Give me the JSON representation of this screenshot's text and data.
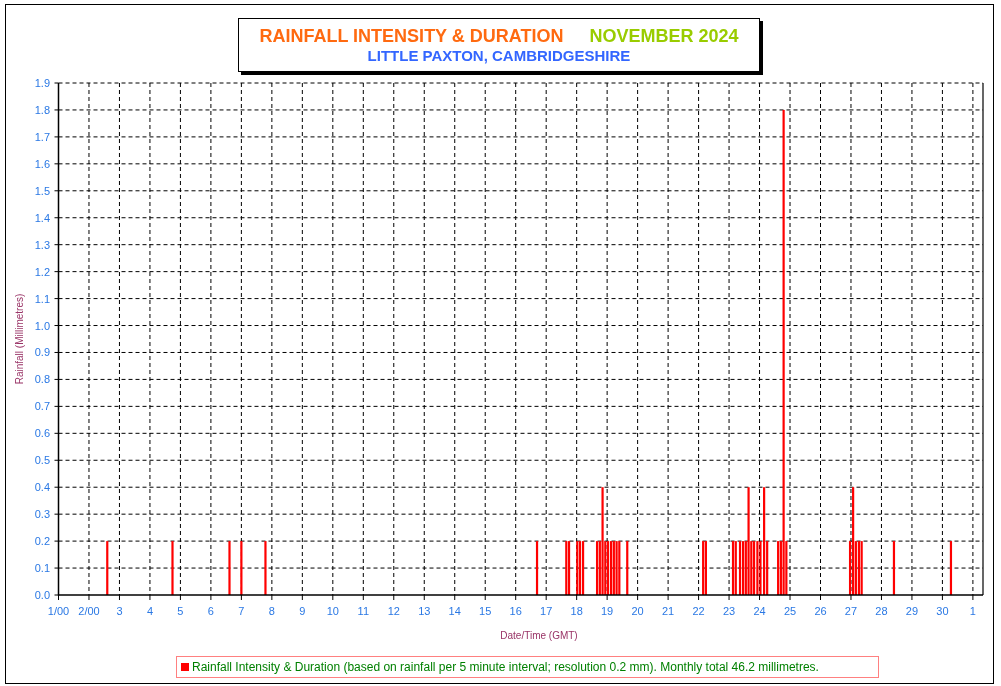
{
  "x_axis": {
    "next_month_label": "1"
  },
  "title": {
    "main": "RAINFALL INTENSITY & DURATION",
    "period": "NOVEMBER 2024",
    "location": "LITTLE PAXTON, CAMBRIDGESHIRE"
  },
  "chart_data": {
    "type": "bar",
    "xlabel": "Date/Time (GMT)",
    "ylabel": "Rainfall (Millimetres)",
    "xlim": [
      1,
      31
    ],
    "ylim": [
      0,
      1.9
    ],
    "xticks": [
      {
        "value": 1,
        "label": "1/00"
      },
      {
        "value": 2,
        "label": "2/00"
      },
      3,
      4,
      5,
      6,
      7,
      8,
      9,
      10,
      11,
      12,
      13,
      14,
      15,
      16,
      17,
      18,
      19,
      20,
      21,
      22,
      23,
      24,
      25,
      26,
      27,
      28,
      29,
      30
    ],
    "yticks": [
      {
        "value": 0,
        "label": "0.0"
      },
      {
        "value": 0.1,
        "label": "0.1"
      },
      {
        "value": 0.2,
        "label": "0.2"
      },
      {
        "value": 0.3,
        "label": "0.3"
      },
      {
        "value": 0.4,
        "label": "0.4"
      },
      {
        "value": 0.5,
        "label": "0.5"
      },
      {
        "value": 0.6,
        "label": "0.6"
      },
      {
        "value": 0.7,
        "label": "0.7"
      },
      {
        "value": 0.8,
        "label": "0.8"
      },
      {
        "value": 0.9,
        "label": "0.9"
      },
      {
        "value": 1,
        "label": "1.0"
      },
      {
        "value": 1.1,
        "label": "1.1"
      },
      {
        "value": 1.2,
        "label": "1.2"
      },
      {
        "value": 1.3,
        "label": "1.3"
      },
      {
        "value": 1.4,
        "label": "1.4"
      },
      {
        "value": 1.5,
        "label": "1.5"
      },
      {
        "value": 1.6,
        "label": "1.6"
      },
      {
        "value": 1.7,
        "label": "1.7"
      },
      {
        "value": 1.8,
        "label": "1.8"
      },
      {
        "value": 1.9,
        "label": "1.9"
      }
    ],
    "grid": true,
    "x": [
      2.6,
      4.74,
      6.61,
      7.0,
      7.79,
      16.7,
      17.66,
      17.75,
      18.02,
      18.11,
      18.21,
      18.67,
      18.76,
      18.85,
      18.94,
      19.03,
      19.13,
      19.22,
      19.31,
      19.4,
      19.66,
      22.15,
      22.24,
      23.13,
      23.22,
      23.36,
      23.46,
      23.55,
      23.64,
      23.73,
      23.82,
      23.93,
      24.03,
      24.15,
      24.25,
      24.61,
      24.7,
      24.79,
      24.88,
      26.97,
      27.07,
      27.16,
      27.26,
      27.35,
      28.41,
      30.28
    ],
    "series": [
      {
        "name": "Rainfall Intensity & Duration (based on rainfall per 5 minute interval; resolution 0.2 mm). Monthly total 46.2 millimetres.",
        "color": "#ff0000",
        "values": [
          0.2,
          0.2,
          0.2,
          0.2,
          0.2,
          0.2,
          0.2,
          0.2,
          0.2,
          0.2,
          0.2,
          0.2,
          0.2,
          0.4,
          0.2,
          0.2,
          0.2,
          0.2,
          0.2,
          0.2,
          0.2,
          0.2,
          0.2,
          0.2,
          0.2,
          0.2,
          0.2,
          0.2,
          0.4,
          0.2,
          0.2,
          0.2,
          0.2,
          0.4,
          0.2,
          0.2,
          0.2,
          1.8,
          0.2,
          0.2,
          0.4,
          0.2,
          0.2,
          0.2,
          0.2,
          0.2
        ]
      }
    ]
  }
}
